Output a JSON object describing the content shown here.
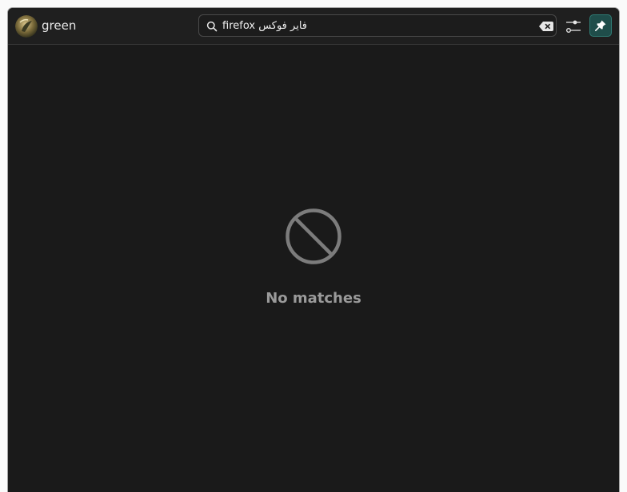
{
  "header": {
    "user_name": "green",
    "avatar_icon": "user-avatar-image",
    "search": {
      "value": "firefox فایر فوکس",
      "icon": "search-icon",
      "clear_icon": "backspace-clear-icon"
    },
    "filter_icon": "sliders-icon",
    "pin_icon": "pin-icon",
    "accent_color": "#1f4d4a"
  },
  "main": {
    "empty_state": {
      "icon": "no-symbol-icon",
      "message": "No matches"
    }
  },
  "colors": {
    "background": "#1a1a1a",
    "headerbar": "#1f1f1f",
    "muted_text": "#9a9a9a"
  }
}
